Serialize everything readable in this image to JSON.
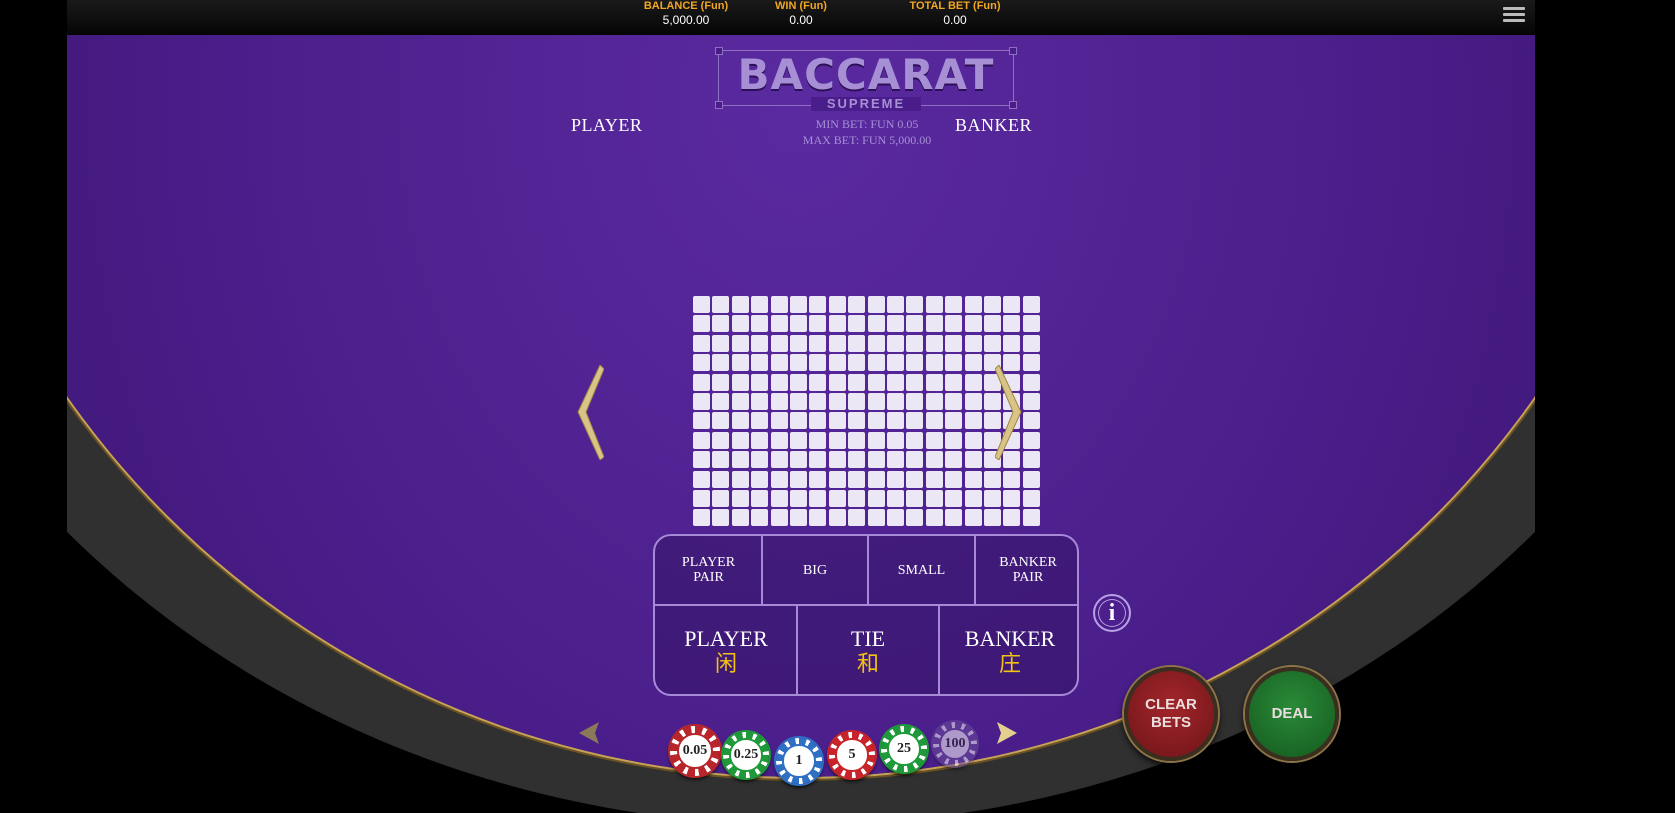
{
  "header": {
    "balance_label": "BALANCE (Fun)",
    "balance_value": "5,000.00",
    "win_label": "WIN (Fun)",
    "win_value": "0.00",
    "total_bet_label": "TOTAL BET (Fun)",
    "total_bet_value": "0.00",
    "menu_icon": "hamburger-menu-icon"
  },
  "logo": {
    "title": "BACCARAT",
    "subtitle": "SUPREME"
  },
  "limits": {
    "min_bet": "MIN BET: FUN 0.05",
    "max_bet": "MAX BET: FUN 5,000.00"
  },
  "table": {
    "player_label": "PLAYER",
    "banker_label": "BANKER"
  },
  "road_grid": {
    "columns": 18,
    "rows": 12
  },
  "side_bets": [
    {
      "line1": "PLAYER",
      "line2": "PAIR"
    },
    {
      "line1": "BIG",
      "line2": ""
    },
    {
      "line1": "SMALL",
      "line2": ""
    },
    {
      "line1": "BANKER",
      "line2": "PAIR"
    }
  ],
  "main_bets": [
    {
      "label": "PLAYER",
      "chinese": "闲"
    },
    {
      "label": "TIE",
      "chinese": "和"
    },
    {
      "label": "BANKER",
      "chinese": "庄"
    }
  ],
  "info_button": "i",
  "chips": [
    {
      "label": "0.05",
      "color": "#b8262b"
    },
    {
      "label": "0.25",
      "color": "#1f9a3a"
    },
    {
      "label": "1",
      "color": "#2f6fc4"
    },
    {
      "label": "5",
      "color": "#c8242a"
    },
    {
      "label": "25",
      "color": "#1f9a3a"
    },
    {
      "label": "100",
      "color": "#6a4e9c"
    }
  ],
  "buttons": {
    "clear_bets_line1": "CLEAR",
    "clear_bets_line2": "BETS",
    "deal": "DEAL"
  },
  "colors": {
    "accent_gold": "#c7a25a",
    "header_label": "#f2a623",
    "felt": "#4a1e8a",
    "clear_button": "#8b1a1e",
    "deal_button": "#1f6b2a"
  }
}
